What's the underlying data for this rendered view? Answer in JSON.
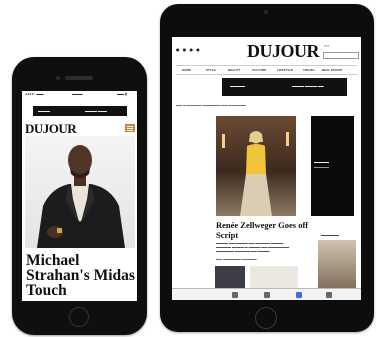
{
  "tablet": {
    "logo": "DUJOUR",
    "headline": "Renée Zellweger Goes off Script",
    "nav_items": [
      "HOME",
      "STYLE",
      "BEAUTY",
      "CULTURE",
      "LIFESTYLE",
      "TRAVEL",
      "REAL ESTATE"
    ]
  },
  "phone": {
    "logo": "DUJOUR",
    "headline": "Michael Strahan's Midas Touch"
  },
  "colors": {
    "device_body": "#0f0f0f",
    "menu_accent": "#e07b39",
    "active_tab": "#3d6fd9"
  }
}
